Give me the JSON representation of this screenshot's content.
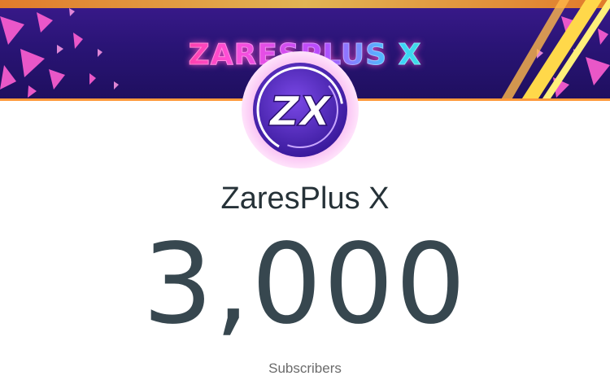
{
  "banner": {
    "title": "ZARESPLUS X",
    "colors": {
      "background": "#2a1476",
      "stripes": "#ffd84a",
      "accent": "#ff4fd8"
    }
  },
  "avatar": {
    "logo_text": "ZX",
    "icon": "zx-logo-icon",
    "colors": {
      "ring": "#f7b6f0",
      "disc": "#5a2bc8",
      "glyph": "#ffffff"
    }
  },
  "channel": {
    "name": "ZaresPlus X"
  },
  "stats": {
    "subscriber_count": "3,000",
    "subscriber_label": "Subscribers"
  }
}
